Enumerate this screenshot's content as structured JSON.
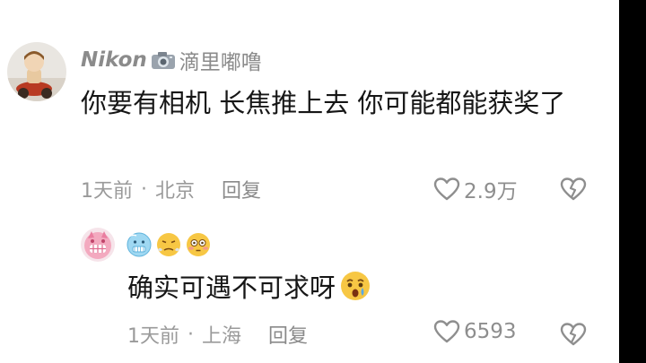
{
  "comment": {
    "username": "Nikon",
    "username_suffix": "滴里嘟噜",
    "text": "你要有相机 长焦推上去 你可能都能获奖了",
    "time": "1天前",
    "location": "北京",
    "reply_label": "回复",
    "likes": "2.9万"
  },
  "reply": {
    "text": "确实可遇不可求呀",
    "time": "1天前",
    "location": "上海",
    "reply_label": "回复",
    "likes": "6593"
  },
  "icons": [
    "camera-icon",
    "heart-icon",
    "dislike-icon",
    "cold-face-emoji",
    "steam-face-emoji",
    "flushed-face-emoji",
    "crying-face-emoji"
  ],
  "colors": {
    "username": "#8b8b8b",
    "meta": "#9a9a9a",
    "text": "#161616",
    "emoji_yellow": "#f7c744",
    "emoji_blue": "#9fd8f2"
  }
}
